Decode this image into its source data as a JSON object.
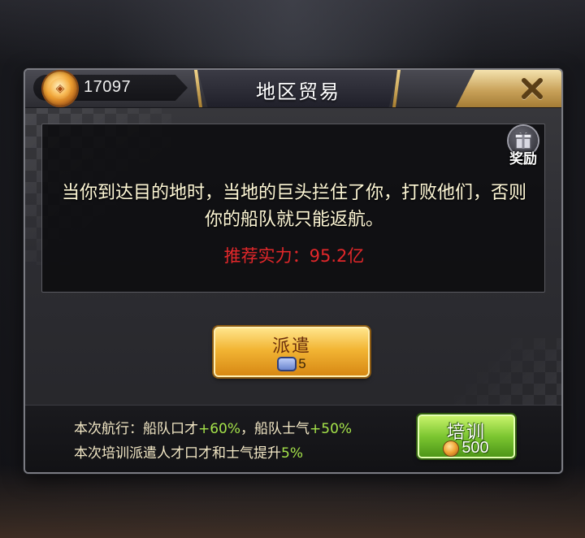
{
  "header": {
    "coin_count": "17097",
    "title": "地区贸易",
    "close_icon": "close-x-icon",
    "coin_icon": "gold-coin-icon"
  },
  "mission": {
    "reward_label": "奖励",
    "reward_icon": "gift-box-icon",
    "description": "当你到达目的地时，当地的巨头拦住了你，打败他们，否则你的船队就只能返航。",
    "recommended_power": "推荐实力：95.2亿"
  },
  "dispatch": {
    "label": "派遣",
    "cost_icon": "dispatch-ticket-icon",
    "cost": "5"
  },
  "footer": {
    "line1_prefix": "本次航行：船队口才",
    "line1_eloquence_bonus": "+60%",
    "line1_middle": "，船队士气",
    "line1_morale_bonus": "+50%",
    "line2_prefix": "本次培训派遣人才口才和士气提升",
    "line2_bonus": "5%"
  },
  "train": {
    "label": "培训",
    "cost_icon": "gold-coin-icon",
    "cost": "500"
  },
  "colors": {
    "power_text": "#e2272a",
    "bonus_text": "#a5e34a",
    "dispatch_button": "#f2b534",
    "train_button": "#7cc631"
  }
}
